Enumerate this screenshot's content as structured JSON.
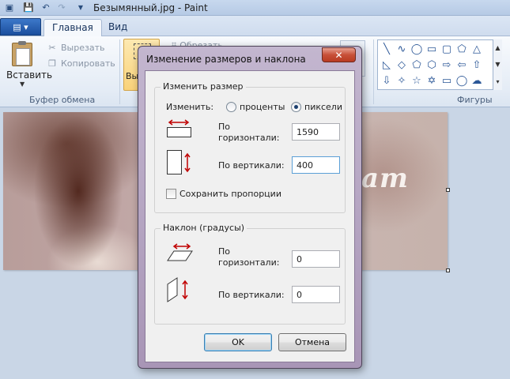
{
  "window": {
    "title": "Безымянный.jpg - Paint"
  },
  "tabs": {
    "file_label": "▤ ▾",
    "home": "Главная",
    "view": "Вид"
  },
  "ribbon": {
    "paste": "Вставить",
    "cut": "Вырезать",
    "copy": "Копировать",
    "clipboard_group": "Буфер обмена",
    "select_partial": "Выд",
    "crop": "Обрезать",
    "shapes_group": "Фигуры"
  },
  "canvas": {
    "image_text": "am"
  },
  "dialog": {
    "title": "Изменение размеров и наклона",
    "close_glyph": "✕",
    "resize": {
      "group_title": "Изменить размер",
      "by_label": "Изменить:",
      "percent_label": "проценты",
      "pixels_label": "пиксели",
      "selected_mode": "пиксели",
      "horizontal_label_1": "По",
      "horizontal_label_2": "горизонтали:",
      "horizontal_value": "1590",
      "vertical_label": "По вертикали:",
      "vertical_value": "400",
      "keep_ratio_label": "Сохранить пропорции",
      "keep_ratio_checked": false
    },
    "skew": {
      "group_title": "Наклон (градусы)",
      "horizontal_label_1": "По",
      "horizontal_label_2": "горизонтали:",
      "horizontal_value": "0",
      "vertical_label": "По вертикали:",
      "vertical_value": "0"
    },
    "ok_label": "OK",
    "cancel_label": "Отмена"
  }
}
